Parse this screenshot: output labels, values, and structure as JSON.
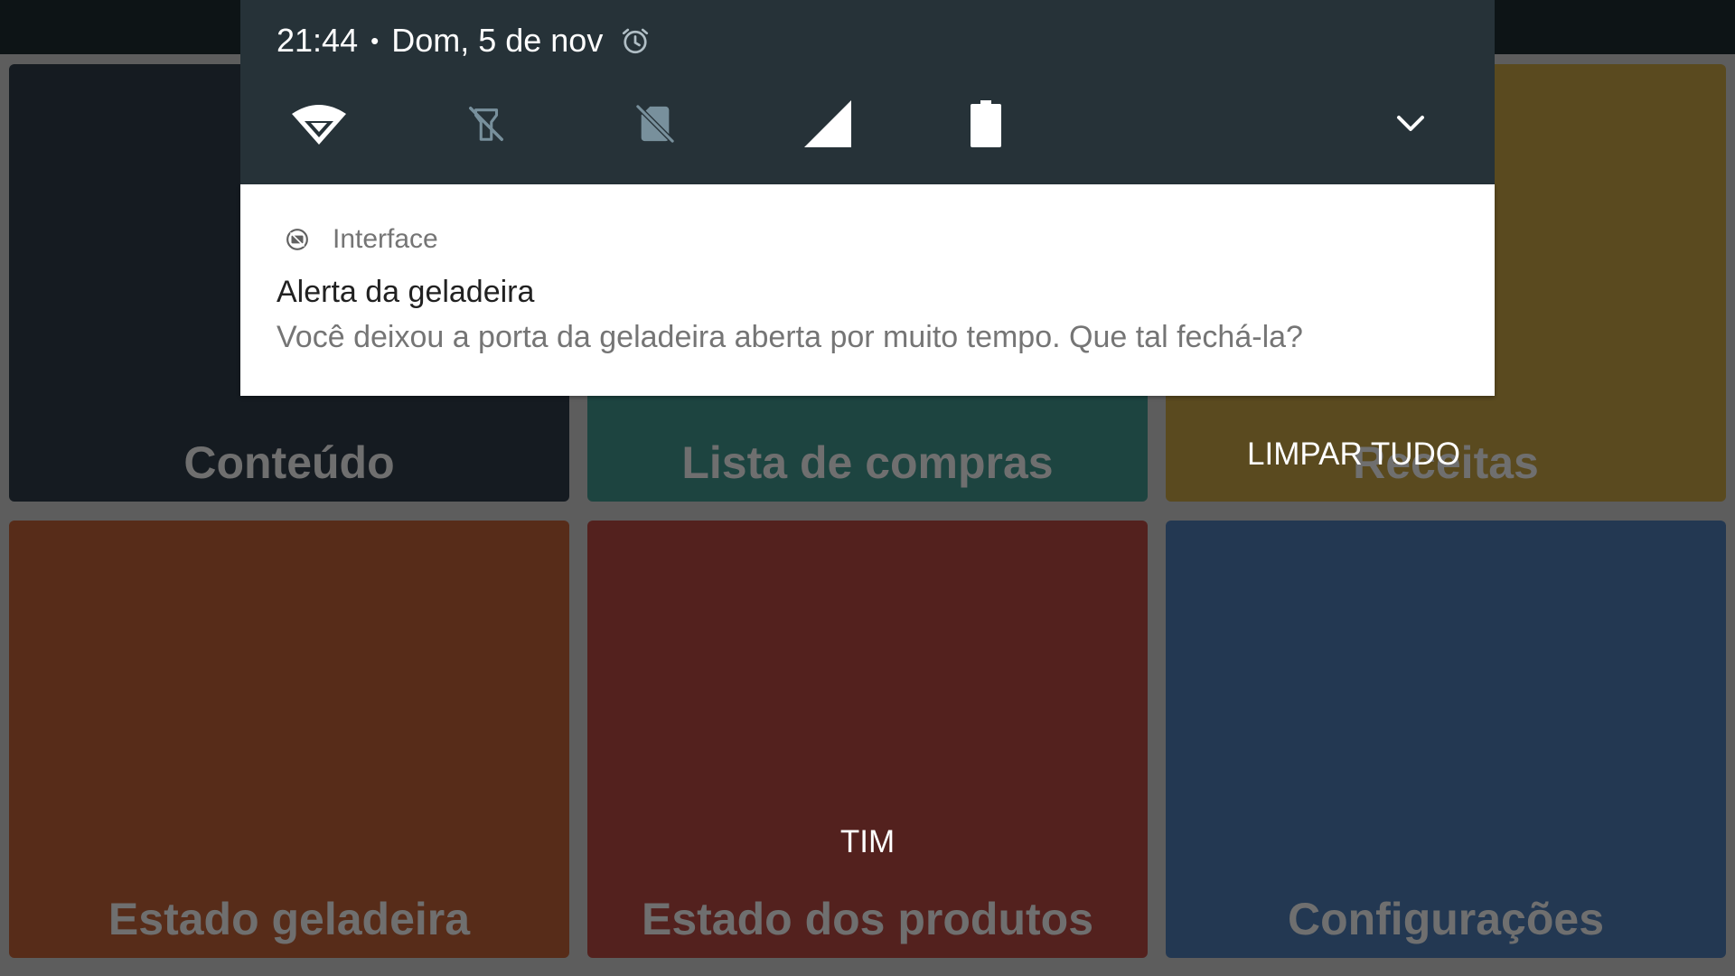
{
  "status_bar": {
    "time": "21:44",
    "separator": "•",
    "date": "Dom, 5 de nov"
  },
  "quick_settings": [
    {
      "icon": "wifi-icon"
    },
    {
      "icon": "flashlight-off-icon"
    },
    {
      "icon": "no-sim-icon"
    },
    {
      "icon": "cell-signal-icon"
    },
    {
      "icon": "battery-icon"
    },
    {
      "icon": "chevron-down-icon"
    }
  ],
  "notification": {
    "app_icon": "app-icon",
    "app_name": "Interface",
    "title": "Alerta da geladeira",
    "text": "Você deixou a porta da geladeira aberta por muito tempo. Que tal fechá-la?"
  },
  "clear_all_label": "LIMPAR TUDO",
  "carrier_label": "TIM",
  "tiles": [
    {
      "label": "Conteúdo",
      "color": "#151b21"
    },
    {
      "label": "Lista de compras",
      "color": "#1d4440"
    },
    {
      "label": "Receitas",
      "color": "#5a4a1f"
    },
    {
      "label": "Estado geladeira",
      "color": "#572c19"
    },
    {
      "label": "Estado dos produtos",
      "color": "#53211e"
    },
    {
      "label": "Configurações",
      "color": "#233852"
    }
  ],
  "colors": {
    "shade_background": "#263238",
    "notification_background": "#ffffff",
    "scrim": "#5d5d5d"
  }
}
